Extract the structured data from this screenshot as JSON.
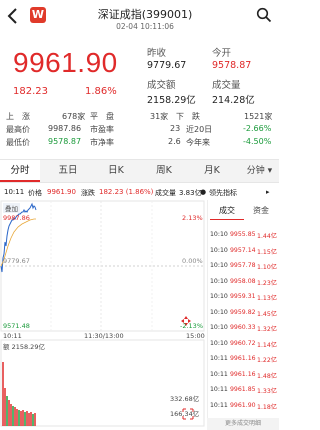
{
  "header": {
    "title": "深证成指(399001)",
    "subtitle": "02-04 10:11:06",
    "logo_text": "W"
  },
  "quote": {
    "price": "9961.90",
    "change": "182.23",
    "change_pct": "1.86%",
    "prev_close_label": "昨收",
    "prev_close": "9779.67",
    "open_label": "今开",
    "open": "9578.87",
    "amount_label": "成交额",
    "amount": "2158.29亿",
    "volume_label": "成交量",
    "volume": "214.28亿"
  },
  "stats": {
    "row1": {
      "k1": "上　涨",
      "v1": "678家",
      "k2": "平　盘",
      "v2": "31家",
      "k3": "下　跌",
      "v3": "1521家"
    },
    "row2": {
      "k1": "最高价",
      "v1": "9987.86",
      "k2": "市盈率",
      "v2": "23",
      "k3": "近20日",
      "v3": "-2.66%"
    },
    "row3": {
      "k1": "最低价",
      "v1": "9578.87",
      "k2": "市净率",
      "v2": "2.6",
      "k3": "今年来",
      "v3": "-4.50%"
    }
  },
  "tabs": [
    "分时",
    "五日",
    "日K",
    "周K",
    "月K",
    "分钟"
  ],
  "info": {
    "time": "10:11",
    "price_label": "价格",
    "price": "9961.90",
    "change_label": "涨跌",
    "change": "182.23 (1.86%)",
    "vol_label": "成交量",
    "vol": "3.83亿",
    "leader": "领先指标"
  },
  "chart": {
    "badge": "叠加",
    "high_label": "9987.86",
    "high_pct": "2.13%",
    "mid_label": "9779.67",
    "mid_pct": "0.00%",
    "low_label": "9571.48",
    "low_pct": "-2.13%",
    "t_start": "10:11",
    "t_mid": "11:30/13:00",
    "t_end": "15:00",
    "vol_amount_label": "额",
    "vol_amount": "2158.29亿",
    "vol_max": "332.68亿",
    "vol_half": "166.34亿"
  },
  "panel": {
    "tab_trades": "成交",
    "tab_funds": "资金",
    "more": "更多成交明细",
    "trades": [
      {
        "t": "10:10",
        "p": "9955.85",
        "v": "1.44亿"
      },
      {
        "t": "10:10",
        "p": "9957.14",
        "v": "1.15亿"
      },
      {
        "t": "10:10",
        "p": "9957.78",
        "v": "1.10亿"
      },
      {
        "t": "10:10",
        "p": "9958.08",
        "v": "1.23亿"
      },
      {
        "t": "10:10",
        "p": "9959.31",
        "v": "1.13亿"
      },
      {
        "t": "10:10",
        "p": "9959.82",
        "v": "1.45亿"
      },
      {
        "t": "10:10",
        "p": "9960.33",
        "v": "1.32亿"
      },
      {
        "t": "10:10",
        "p": "9960.72",
        "v": "1.14亿"
      },
      {
        "t": "10:11",
        "p": "9961.16",
        "v": "1.22亿"
      },
      {
        "t": "10:11",
        "p": "9961.16",
        "v": "1.48亿"
      },
      {
        "t": "10:11",
        "p": "9961.85",
        "v": "1.33亿"
      },
      {
        "t": "10:11",
        "p": "9961.90",
        "v": "1.18亿"
      }
    ]
  },
  "colors": {
    "up": "#e02a2a",
    "down": "#1a9a3a",
    "accent": "#e03a2a"
  }
}
